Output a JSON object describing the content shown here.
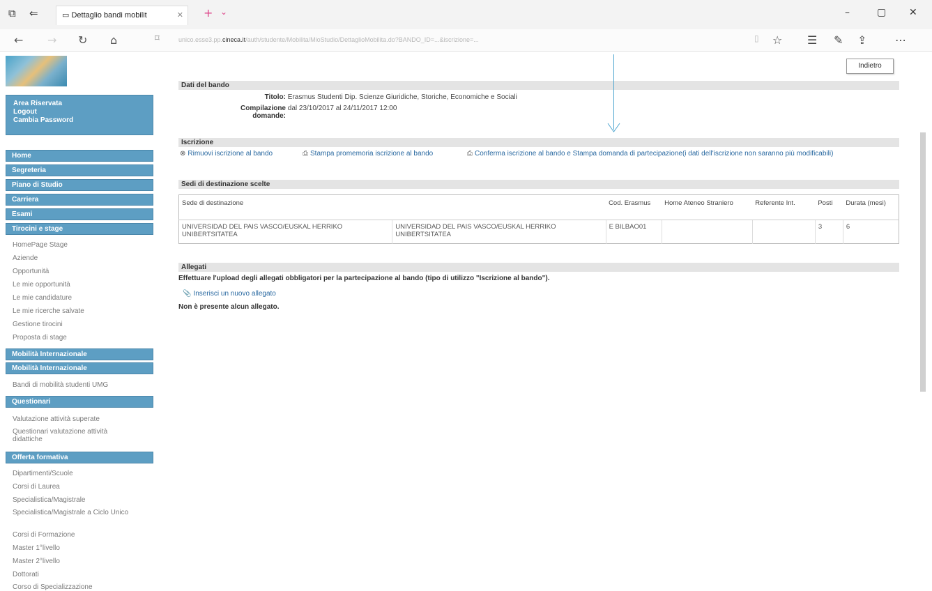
{
  "browser": {
    "tab_title": "Dettaglio bandi mobilit",
    "url_prefix": "unico.esse3.pp.",
    "url_domain": "cineca.it",
    "url_suffix": "/auth/studente/Mobilita/MioStudio/DettaglioMobilita.do?BANDO_ID=...&iscrizione=..."
  },
  "sidebar": {
    "user_area": [
      "Area Riservata",
      "Logout",
      "Cambia Password"
    ],
    "menu": [
      {
        "label": "Home"
      },
      {
        "label": "Segreteria"
      },
      {
        "label": "Piano di Studio"
      },
      {
        "label": "Carriera"
      },
      {
        "label": "Esami"
      },
      {
        "label": "Tirocini e stage"
      }
    ],
    "tirocini_links": [
      "HomePage Stage",
      "Aziende",
      "Opportunità",
      "Le mie opportunità",
      "Le mie candidature",
      "Le mie ricerche salvate",
      "Gestione tirocini",
      "Proposta di stage"
    ],
    "mobilita_header_1": "Mobilità Internazionale",
    "mobilita_header_2": "Mobilità Internazionale",
    "mobilita_links": [
      "Bandi di mobilità studenti UMG"
    ],
    "questionari_header": "Questionari",
    "questionari_links": [
      "Valutazione attività superate",
      "Questionari valutazione attività didattiche"
    ],
    "offerta_header": "Offerta formativa",
    "offerta_links": [
      "Dipartimenti/Scuole",
      "Corsi di Laurea",
      "Specialistica/Magistrale",
      "Specialistica/Magistrale a Ciclo Unico",
      "Corsi di Formazione",
      "Master 1°livello",
      "Master 2°livello",
      "Dottorati",
      "Corso di Specializzazione"
    ]
  },
  "main": {
    "back_button": "Indietro",
    "dati_bando_title": "Dati del bando",
    "titolo_label": "Titolo:",
    "titolo_value": "Erasmus Studenti Dip. Scienze Giuridiche, Storiche, Economiche e Sociali",
    "compilazione_label": "Compilazione domande:",
    "compilazione_value": "dal 23/10/2017 al 24/11/2017 12:00",
    "iscrizione_title": "Iscrizione",
    "action_remove": "Rimuovi iscrizione al bando",
    "action_print": "Stampa promemoria iscrizione al bando",
    "action_confirm": "Conferma iscrizione al bando e Stampa domanda di partecipazione(i dati dell'iscrizione non saranno più modificabili)",
    "sedi_title": "Sedi di destinazione scelte",
    "table_headers": [
      "Sede di destinazione",
      "",
      "Cod. Erasmus",
      "Home Ateneo Straniero",
      "Referente Int.",
      "Posti",
      "Durata (mesi)"
    ],
    "table_rows": [
      [
        "UNIVERSIDAD DEL PAIS VASCO/EUSKAL HERRIKO UNIBERTSITATEA",
        "UNIVERSIDAD DEL PAIS VASCO/EUSKAL HERRIKO UNIBERTSITATEA",
        "E BILBAO01",
        "",
        "",
        "3",
        "6"
      ]
    ],
    "allegati_title": "Allegati",
    "allegati_instructions": "Effettuare l'upload degli allegati obbligatori per la partecipazione al bando (tipo di utilizzo \"Iscrizione al bando\").",
    "insert_link": "Inserisci un nuovo allegato",
    "no_attachments": "Non è presente alcun allegato."
  },
  "icons": {
    "remove": "remove-icon",
    "print": "print-icon",
    "attach": "attachment-icon"
  },
  "colors": {
    "menu_bg": "#5d9ec3",
    "link": "#2868a0",
    "annotation_arrow": "#4fa6d0"
  }
}
